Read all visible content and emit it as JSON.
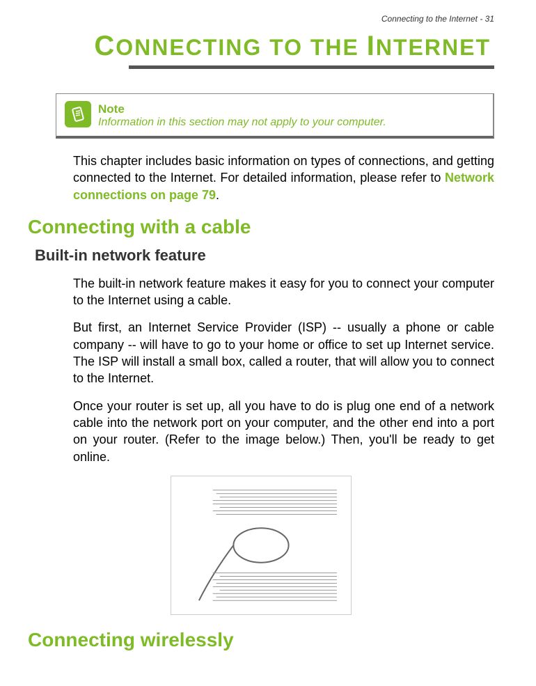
{
  "header": {
    "running_head": "Connecting to the Internet - 31"
  },
  "title": {
    "part1_big": "C",
    "part1_rest": "ONNECTING TO THE",
    "part2_big": "I",
    "part2_rest": "NTERNET"
  },
  "note": {
    "label": "Note",
    "text": "Information in this section may not apply to your computer."
  },
  "intro": {
    "text_before_link": "This chapter includes basic information on types of connections, and getting connected to the Internet. For detailed information, please refer to ",
    "link_text": "Network connections on page 79",
    "text_after_link": "."
  },
  "sections": {
    "cable": {
      "heading": "Connecting with a cable",
      "sub1": {
        "heading": "Built-in network feature",
        "p1": "The built-in network feature makes it easy for you to connect your computer to the Internet using a cable.",
        "p2": "But first, an Internet Service Provider (ISP) -- usually a phone or cable company -- will have to go to your home or office to set up Internet service. The ISP will install a small box, called a router, that will allow you to connect to the Internet.",
        "p3": "Once your router is set up, all you have to do is plug one end of a network cable into the network port on your computer, and the other end into a port on your router. (Refer to the image below.) Then, you'll be ready to get online."
      }
    },
    "wireless": {
      "heading": "Connecting wirelessly"
    }
  }
}
